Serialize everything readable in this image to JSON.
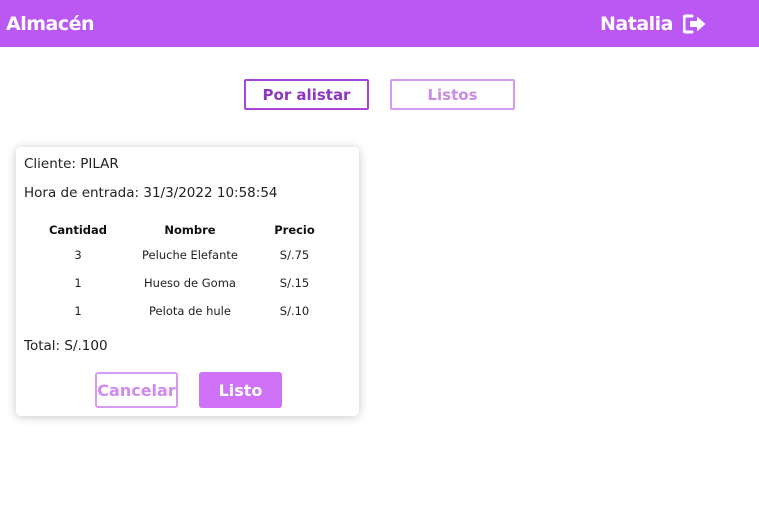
{
  "header": {
    "title": "Almacén",
    "user_name": "Natalia",
    "logout_icon": "logout-icon"
  },
  "tabs": [
    {
      "label": "Por alistar",
      "active": true
    },
    {
      "label": "Listos",
      "active": false
    }
  ],
  "order": {
    "client_label": "Cliente: PILAR",
    "time_label": "Hora de entrada: 31/3/2022 10:58:54",
    "columns": [
      "Cantidad",
      "Nombre",
      "Precio"
    ],
    "items": [
      {
        "qty": "3",
        "name": "Peluche Elefante",
        "price": "S/.75"
      },
      {
        "qty": "1",
        "name": "Hueso de Goma",
        "price": "S/.15"
      },
      {
        "qty": "1",
        "name": "Pelota de hule",
        "price": "S/.10"
      }
    ],
    "total_label": "Total: S/.100",
    "cancel_label": "Cancelar",
    "done_label": "Listo"
  },
  "colors": {
    "header_bg": "#bb57f3",
    "accent_border": "#a844d9",
    "done_button": "#cf72f7"
  }
}
